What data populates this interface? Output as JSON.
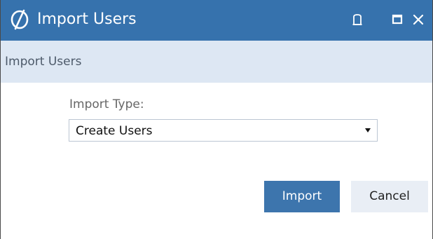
{
  "window": {
    "title": "Import Users",
    "logo_icon": "app-logo-icon",
    "controls": {
      "pin_icon": "pin-icon",
      "maximize_icon": "maximize-icon",
      "close_icon": "close-icon"
    },
    "titlebar_color": "#3672ad"
  },
  "subheader": {
    "title": "Import Users"
  },
  "form": {
    "import_type_label": "Import Type:",
    "import_type_value": "Create Users"
  },
  "actions": {
    "import_label": "Import",
    "cancel_label": "Cancel",
    "primary_color": "#3d75ad"
  }
}
